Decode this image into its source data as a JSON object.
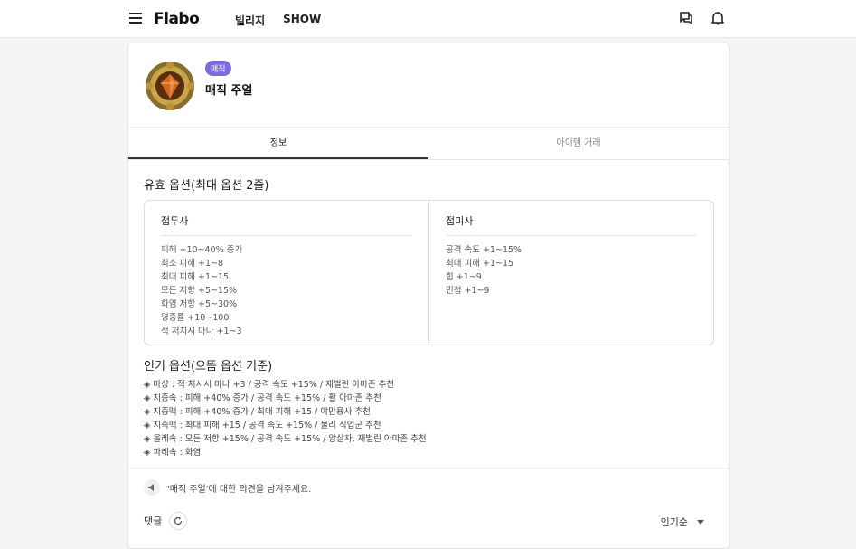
{
  "header": {
    "logo": "Flabo",
    "nav": [
      "빌리지",
      "SHOW"
    ]
  },
  "item": {
    "badge": "매직",
    "name": "매직 주얼",
    "accent_color": "#7c6be0"
  },
  "tabs": [
    {
      "label": "정보",
      "active": true
    },
    {
      "label": "아이템 거래",
      "active": false
    }
  ],
  "valid_options": {
    "title": "유효 옵션(최대 옵션 2줄)",
    "columns": [
      {
        "heading": "접두사",
        "items": [
          "피해 +10~40% 증가",
          "최소 피해 +1~8",
          "최대 피해 +1~15",
          "모든 저항 +5~15%",
          "화염 저항 +5~30%",
          "명중률 +10~100",
          "적 처치시 마나 +1~3"
        ]
      },
      {
        "heading": "접미사",
        "items": [
          "공격 속도 +1~15%",
          "최대 피해 +1~15",
          "힘 +1~9",
          "민첩 +1~9"
        ]
      }
    ]
  },
  "popular_options": {
    "title": "인기 옵션(으뜸 옵션 기준)",
    "items": [
      "◈ 마샹 : 적 처시시 마나 +3 / 공격 속도 +15% / 재벌린 아마존 추천",
      "◈ 지증속 : 피해 +40% 증가 / 공격 속도 +15% / 활 아마존 추천",
      "◈ 지증맥 : 피해 +40% 증가 / 최대 피해 +15 / 야만용사 추천",
      "◈ 지속맥 : 최대 피해 +15 / 공격 속도 +15% / 물리 직업군 추천",
      "◈ 올레속 : 모든 저항 +15% / 공격 속도 +15% / 암살자, 재벌린 아마존 추천",
      "◈ 파레속 : 화염"
    ]
  },
  "feedback": {
    "text": "'매직 주얼'에 대한 의견을 남겨주세요."
  },
  "comments": {
    "label": "댓글",
    "sort": "인기순"
  }
}
